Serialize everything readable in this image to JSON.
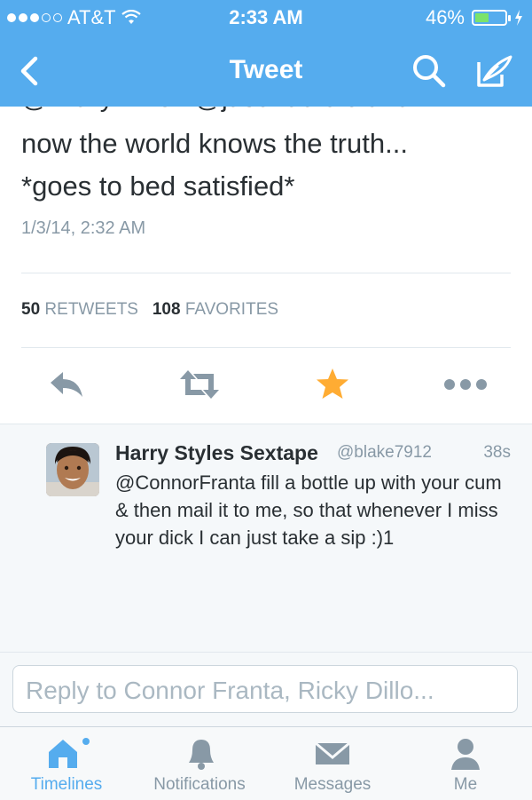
{
  "status_bar": {
    "carrier": "AT&T",
    "time": "2:33 AM",
    "battery": "46%",
    "battery_level": 0.46
  },
  "nav": {
    "title": "Tweet"
  },
  "tweet": {
    "clipped_line": "@Ricky  Dillon @jasonderulo and",
    "text_line1": "now the world knows the truth...",
    "text_line2": "*goes to bed satisfied*",
    "timestamp": "1/3/14, 2:32 AM",
    "retweets_count": "50",
    "retweets_label": "RETWEETS",
    "favorites_count": "108",
    "favorites_label": "FAVORITES"
  },
  "reply": {
    "name": "Harry Styles Sextape",
    "handle": "@blake7912",
    "time": "38s",
    "text": "@ConnorFranta fill a bottle up with your cum & then mail it to me, so that whenever I miss your dick I can just take a sip :)1"
  },
  "composer": {
    "placeholder": "Reply to Connor Franta, Ricky Dillo..."
  },
  "tabs": [
    {
      "label": "Timelines",
      "icon": "home-icon",
      "active": true
    },
    {
      "label": "Notifications",
      "icon": "bell-icon",
      "active": false
    },
    {
      "label": "Messages",
      "icon": "envelope-icon",
      "active": false
    },
    {
      "label": "Me",
      "icon": "person-icon",
      "active": false
    }
  ],
  "colors": {
    "brand": "#55acee",
    "favorite_star": "#ffac33",
    "muted": "#8899a6"
  }
}
